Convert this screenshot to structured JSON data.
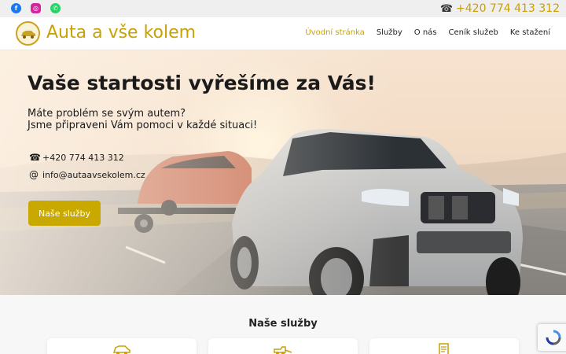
{
  "topbar": {
    "social": [
      {
        "name": "facebook",
        "glyph": "f"
      },
      {
        "name": "instagram",
        "glyph": "◎"
      },
      {
        "name": "whatsapp",
        "glyph": "✆"
      }
    ],
    "phone_icon": "☎",
    "phone": "+420 774 413 312"
  },
  "header": {
    "brand": "Auta a vše kolem",
    "nav": [
      "Úvodní stránka",
      "Služby",
      "O nás",
      "Ceník služeb",
      "Ke stažení"
    ],
    "active_nav": "Úvodní stránka"
  },
  "hero": {
    "title": "Vaše startosti vyřešíme za Vás!",
    "lead_line1": "Máte problém se svým autem?",
    "lead_line2": "Jsme připraveni Vám pomoci v každé situaci!",
    "phone_icon": "☎",
    "phone": "+420 774 413 312",
    "email_icon": "@",
    "email": "info@autaavsekolem.cz",
    "button": "Naše služby"
  },
  "services": {
    "heading": "Naše služby",
    "cards": [
      {
        "icon": "car-icon"
      },
      {
        "icon": "tow-truck-icon"
      },
      {
        "icon": "document-icon"
      }
    ]
  },
  "colors": {
    "accent": "#c9a100",
    "button": "#c9a800",
    "facebook": "#1877f2",
    "instagram": "#d6249f",
    "whatsapp": "#25d366"
  }
}
